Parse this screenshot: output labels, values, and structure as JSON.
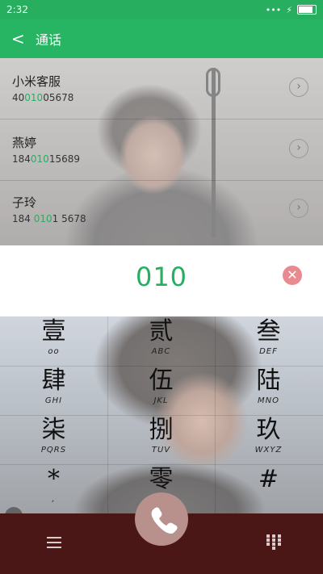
{
  "status_bar": {
    "time": "2:32",
    "dots": "•••"
  },
  "header": {
    "back_label": "<",
    "title": "通话"
  },
  "contacts": [
    {
      "name": "小米客服",
      "number_pre": "40",
      "number_hl": "010",
      "number_post": "05678"
    },
    {
      "name": "燕婷",
      "number_pre": "184",
      "number_hl": "010",
      "number_post": "15689"
    },
    {
      "name": "子玲",
      "number_pre": "184 ",
      "number_hl": "010",
      "number_post": "1 5678"
    }
  ],
  "input": {
    "digits": "010"
  },
  "keypad": [
    {
      "glyph": "壹",
      "sub": "oo"
    },
    {
      "glyph": "贰",
      "sub": "ABC"
    },
    {
      "glyph": "叁",
      "sub": "DEF"
    },
    {
      "glyph": "肆",
      "sub": "GHI"
    },
    {
      "glyph": "伍",
      "sub": "JKL"
    },
    {
      "glyph": "陆",
      "sub": "MNO"
    },
    {
      "glyph": "柒",
      "sub": "PQRS"
    },
    {
      "glyph": "捌",
      "sub": "TUV"
    },
    {
      "glyph": "玖",
      "sub": "WXYZ"
    },
    {
      "glyph": "*",
      "sub": ","
    },
    {
      "glyph": "零",
      "sub": "+"
    },
    {
      "glyph": "#",
      "sub": ""
    }
  ],
  "icons": {
    "back": "back-arrow-icon",
    "chevron": "chevron-right-icon",
    "clear": "clear-icon",
    "menu": "menu-icon",
    "call": "phone-icon",
    "dialpad": "dialpad-icon"
  },
  "colors": {
    "accent": "#27b463",
    "highlight": "#27ae60",
    "bottom_bar": "#4a1616",
    "call_button": "#b8918c",
    "clear_button": "#e98a90"
  }
}
